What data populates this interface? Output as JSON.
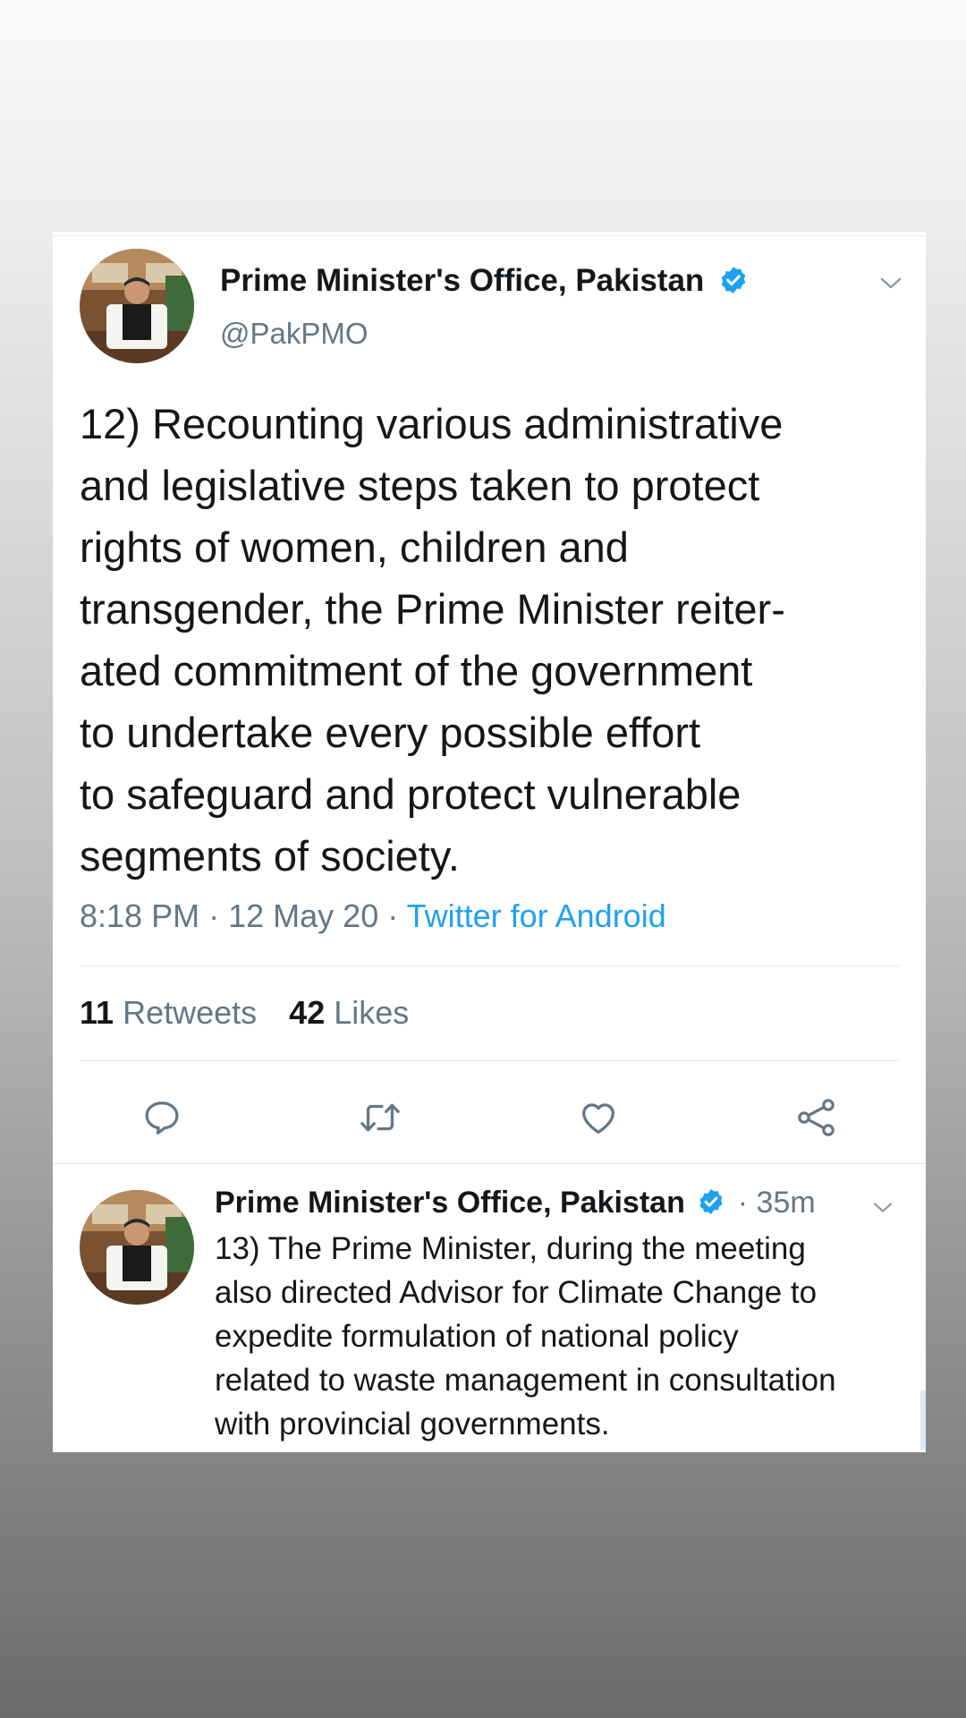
{
  "main_tweet": {
    "author_name": "Prime Minister's Office, Pakistan",
    "handle": "@PakPMO",
    "text_lines": [
      "12) Recounting various administrative",
      "and legislative steps taken to protect",
      "rights of women, children and",
      "transgender, the Prime Minister reiter-",
      "ated commitment of the government",
      "to undertake every possible effort",
      "to safeguard and protect vulnerable",
      "segments of society."
    ],
    "time": "8:18 PM",
    "date": "12 May 20",
    "source": "Twitter for Android",
    "retweets_count": "11",
    "retweets_label": "Retweets",
    "likes_count": "42",
    "likes_label": "Likes"
  },
  "reply_tweet": {
    "author_name": "Prime Minister's Office, Pakistan",
    "age": "35m",
    "text_lines": [
      "13) The Prime Minister, during the meeting",
      "also directed Advisor for Climate Change to",
      "expedite formulation of national policy",
      "related to waste management in consultation",
      "with provincial governments."
    ]
  },
  "separator": "·",
  "icons": {
    "verified": "verified-badge-icon",
    "more": "chevron-down-icon",
    "reply": "reply-icon",
    "retweet": "retweet-icon",
    "like": "heart-icon",
    "share": "share-icon"
  },
  "colors": {
    "accent": "#1da1f2",
    "text_primary": "#14171a",
    "text_secondary": "#657786",
    "divider": "#e1e8ed"
  }
}
